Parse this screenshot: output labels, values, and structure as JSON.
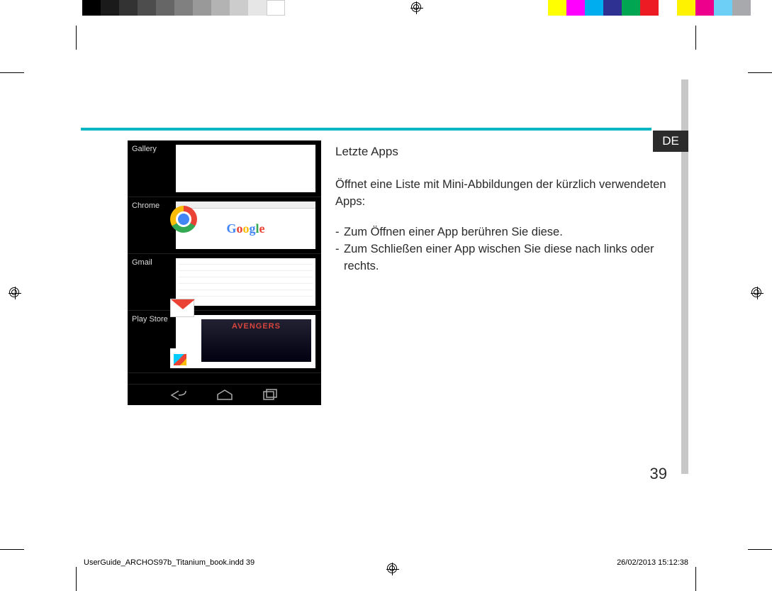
{
  "lang_tab": "DE",
  "content": {
    "heading": "Letzte Apps",
    "intro": "Öffnet eine Liste mit Mini-Abbildungen der kürzlich verwendeten Apps:",
    "bullets": [
      "Zum Öffnen einer App berühren Sie diese.",
      "Zum Schließen einer App wischen Sie diese nach links oder rechts."
    ]
  },
  "phone": {
    "apps": [
      {
        "label": "Gallery"
      },
      {
        "label": "Chrome"
      },
      {
        "label": "Gmail"
      },
      {
        "label": "Play Store"
      }
    ],
    "google_word": "Google",
    "avengers_label": "AVENGERS"
  },
  "page_number": "39",
  "imprint": {
    "file": "UserGuide_ARCHOS97b_Titanium_book.indd   39",
    "date": "26/02/2013   15:12:38"
  },
  "colorbar": {
    "grays": [
      "#000000",
      "#1a1a1a",
      "#333333",
      "#4d4d4d",
      "#666666",
      "#808080",
      "#999999",
      "#b3b3b3",
      "#cccccc",
      "#e6e6e6",
      "#ffffff"
    ],
    "colors": [
      "#ffff00",
      "#ff00ff",
      "#00aeef",
      "#2e3192",
      "#00a651",
      "#ed1c24",
      "#ffffff",
      "#fff200",
      "#ec008c",
      "#6dcff6",
      "#a8a9ad"
    ]
  }
}
